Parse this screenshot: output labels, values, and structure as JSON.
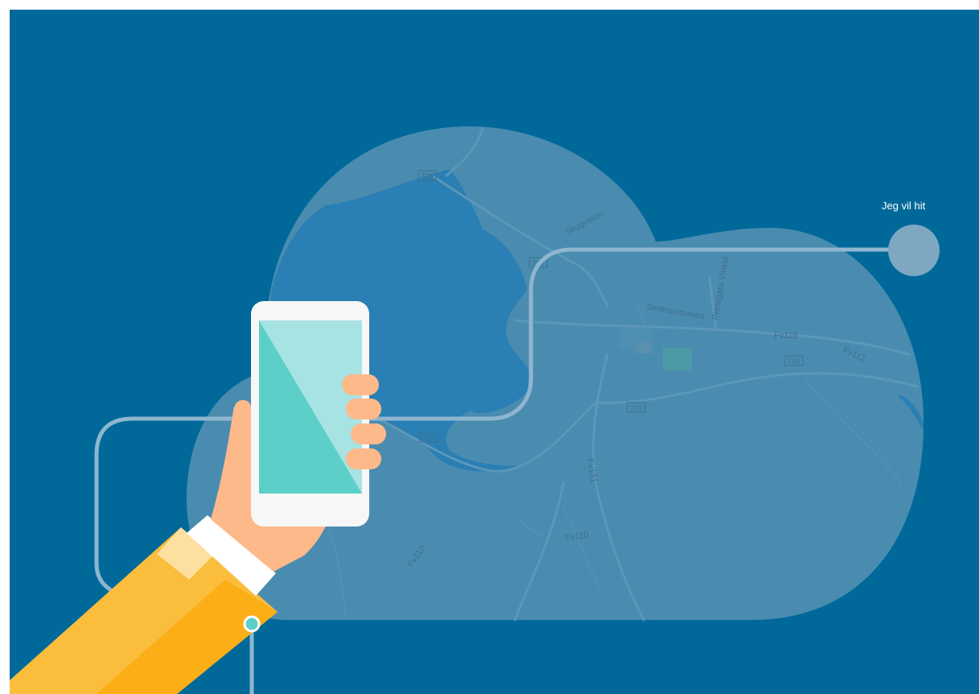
{
  "destination": {
    "label": "Jeg vil hit"
  },
  "map": {
    "labels": {
      "skogveien": "Skogveien",
      "sentrumsveien": "Sentrumsveien",
      "prestegata": "Prestgata Vinkel",
      "fv118": "Fv118",
      "fv112": "Fv112",
      "fv131": "Fv131",
      "fv110_a": "Fv110",
      "fv110_b": "Fv110"
    },
    "shields": {
      "r721": "721",
      "r710_a": "710",
      "r710_b": "710",
      "r710_c": "710",
      "r710_d": "710"
    }
  },
  "colors": {
    "background": "#00699a",
    "cloud": "#4a8cb0",
    "lake": "#2a7fb4",
    "route": "#8fb6cf",
    "phone_screen": "#5ccfc8",
    "sleeve": "#fbbd3c",
    "skin": "#fdb98a"
  },
  "icons": {
    "phone": "smartphone-icon",
    "pin": "destination-pin-icon"
  }
}
